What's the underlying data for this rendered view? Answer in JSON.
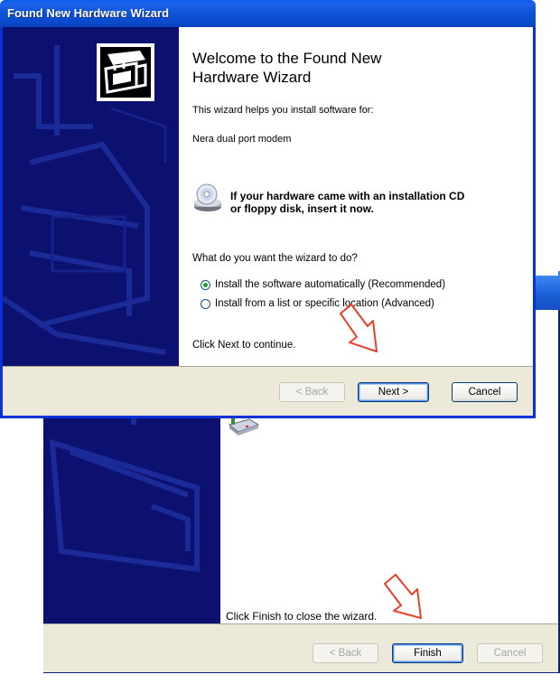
{
  "back_window": {
    "finish_text": "Click Finish to close the wizard.",
    "buttons": {
      "back_label": "< Back",
      "finish_label": "Finish",
      "cancel_label": "Cancel"
    }
  },
  "wizard": {
    "title": "Found New Hardware Wizard",
    "heading_line1": "Welcome to the Found New",
    "heading_line2": "Hardware Wizard",
    "intro_text": "This wizard helps you install software for:",
    "device_name": "Nera dual port modem",
    "cd_line1": "If your hardware came with an installation CD",
    "cd_line2": "or floppy disk, insert it now.",
    "question": "What do you want the wizard to do?",
    "options": [
      {
        "label": "Install the software automatically (Recommended)",
        "selected": true
      },
      {
        "label": "Install from a list or specific location (Advanced)",
        "selected": false
      }
    ],
    "continue_text": "Click Next to continue.",
    "buttons": {
      "back_label": "< Back",
      "next_label": "Next >",
      "cancel_label": "Cancel"
    }
  },
  "colors": {
    "sidebar": "#0c106f",
    "titlebar": "#0a48c8",
    "button_face": "#ece9d8",
    "annotation_arrow": "#e8412b"
  }
}
